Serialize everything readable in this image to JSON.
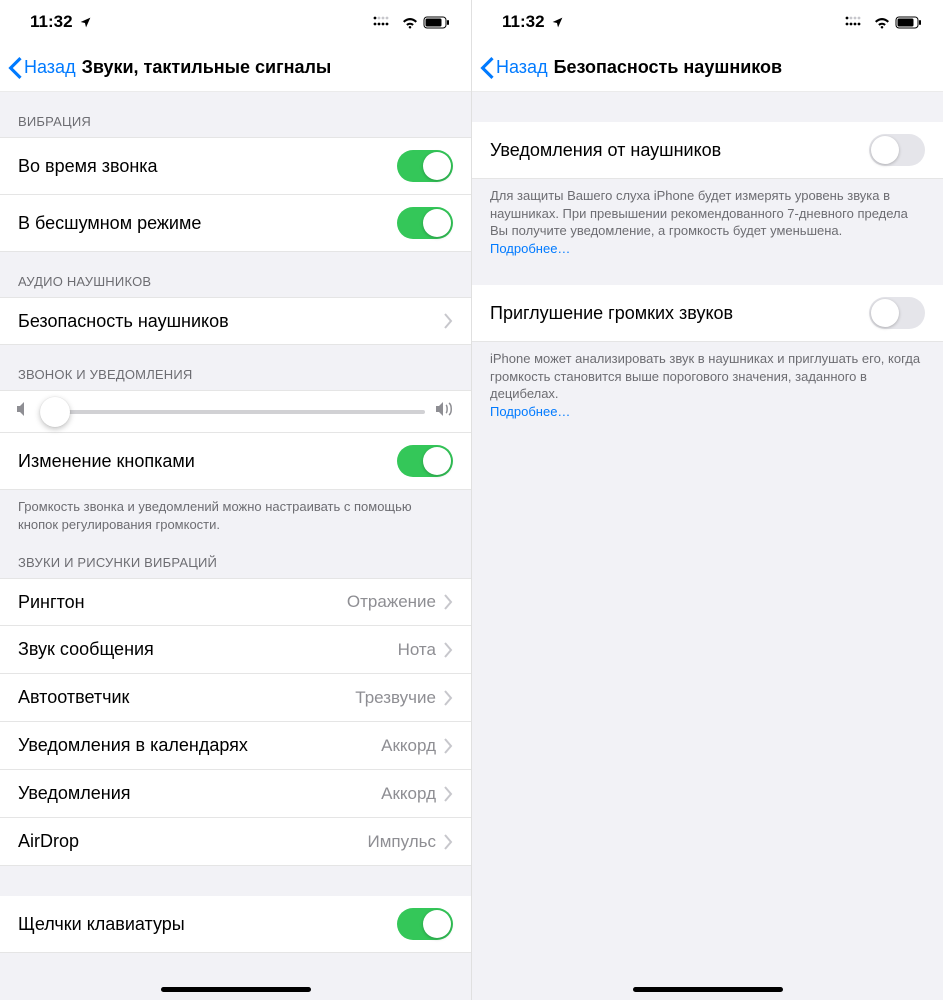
{
  "left": {
    "status": {
      "time": "11:32"
    },
    "nav": {
      "back": "Назад",
      "title": "Звуки, тактильные сигналы"
    },
    "sections": {
      "vibration": {
        "header": "ВИБРАЦИЯ",
        "rows": {
          "duringCall": {
            "label": "Во время звонка",
            "on": true
          },
          "silentMode": {
            "label": "В бесшумном режиме",
            "on": true
          }
        }
      },
      "audio": {
        "header": "АУДИО НАУШНИКОВ",
        "rows": {
          "safety": {
            "label": "Безопасность наушников"
          }
        }
      },
      "ringer": {
        "header": "ЗВОНОК И УВЕДОМЛЕНИЯ",
        "changeWithButtons": {
          "label": "Изменение кнопками",
          "on": true
        },
        "footer": "Громкость звонка и уведомлений можно настраивать с помощью кнопок регулирования громкости."
      },
      "sounds": {
        "header": "ЗВУКИ И РИСУНКИ ВИБРАЦИЙ",
        "rows": {
          "ringtone": {
            "label": "Рингтон",
            "value": "Отражение"
          },
          "textTone": {
            "label": "Звук сообщения",
            "value": "Нота"
          },
          "voicemail": {
            "label": "Автоответчик",
            "value": "Трезвучие"
          },
          "calendar": {
            "label": "Уведомления в календарях",
            "value": "Аккорд"
          },
          "reminders": {
            "label": "Уведомления",
            "value": "Аккорд"
          },
          "airdrop": {
            "label": "AirDrop",
            "value": "Импульс"
          }
        }
      },
      "keyboard": {
        "clicks": {
          "label": "Щелчки клавиатуры",
          "on": true
        }
      }
    }
  },
  "right": {
    "status": {
      "time": "11:32"
    },
    "nav": {
      "back": "Назад",
      "title": "Безопасность наушников"
    },
    "notifications": {
      "label": "Уведомления от наушников",
      "on": false,
      "footer": "Для защиты Вашего слуха iPhone будет измерять уровень звука в наушниках. При превышении рекомендованного 7-дневного предела Вы получите уведомление, а громкость будет уменьшена.",
      "more": "Подробнее…"
    },
    "reduce": {
      "label": "Приглушение громких звуков",
      "on": false,
      "footer": "iPhone может анализировать звук в наушниках и приглушать его, когда громкость становится выше порогового значения, заданного в децибелах.",
      "more": "Подробнее…"
    }
  }
}
